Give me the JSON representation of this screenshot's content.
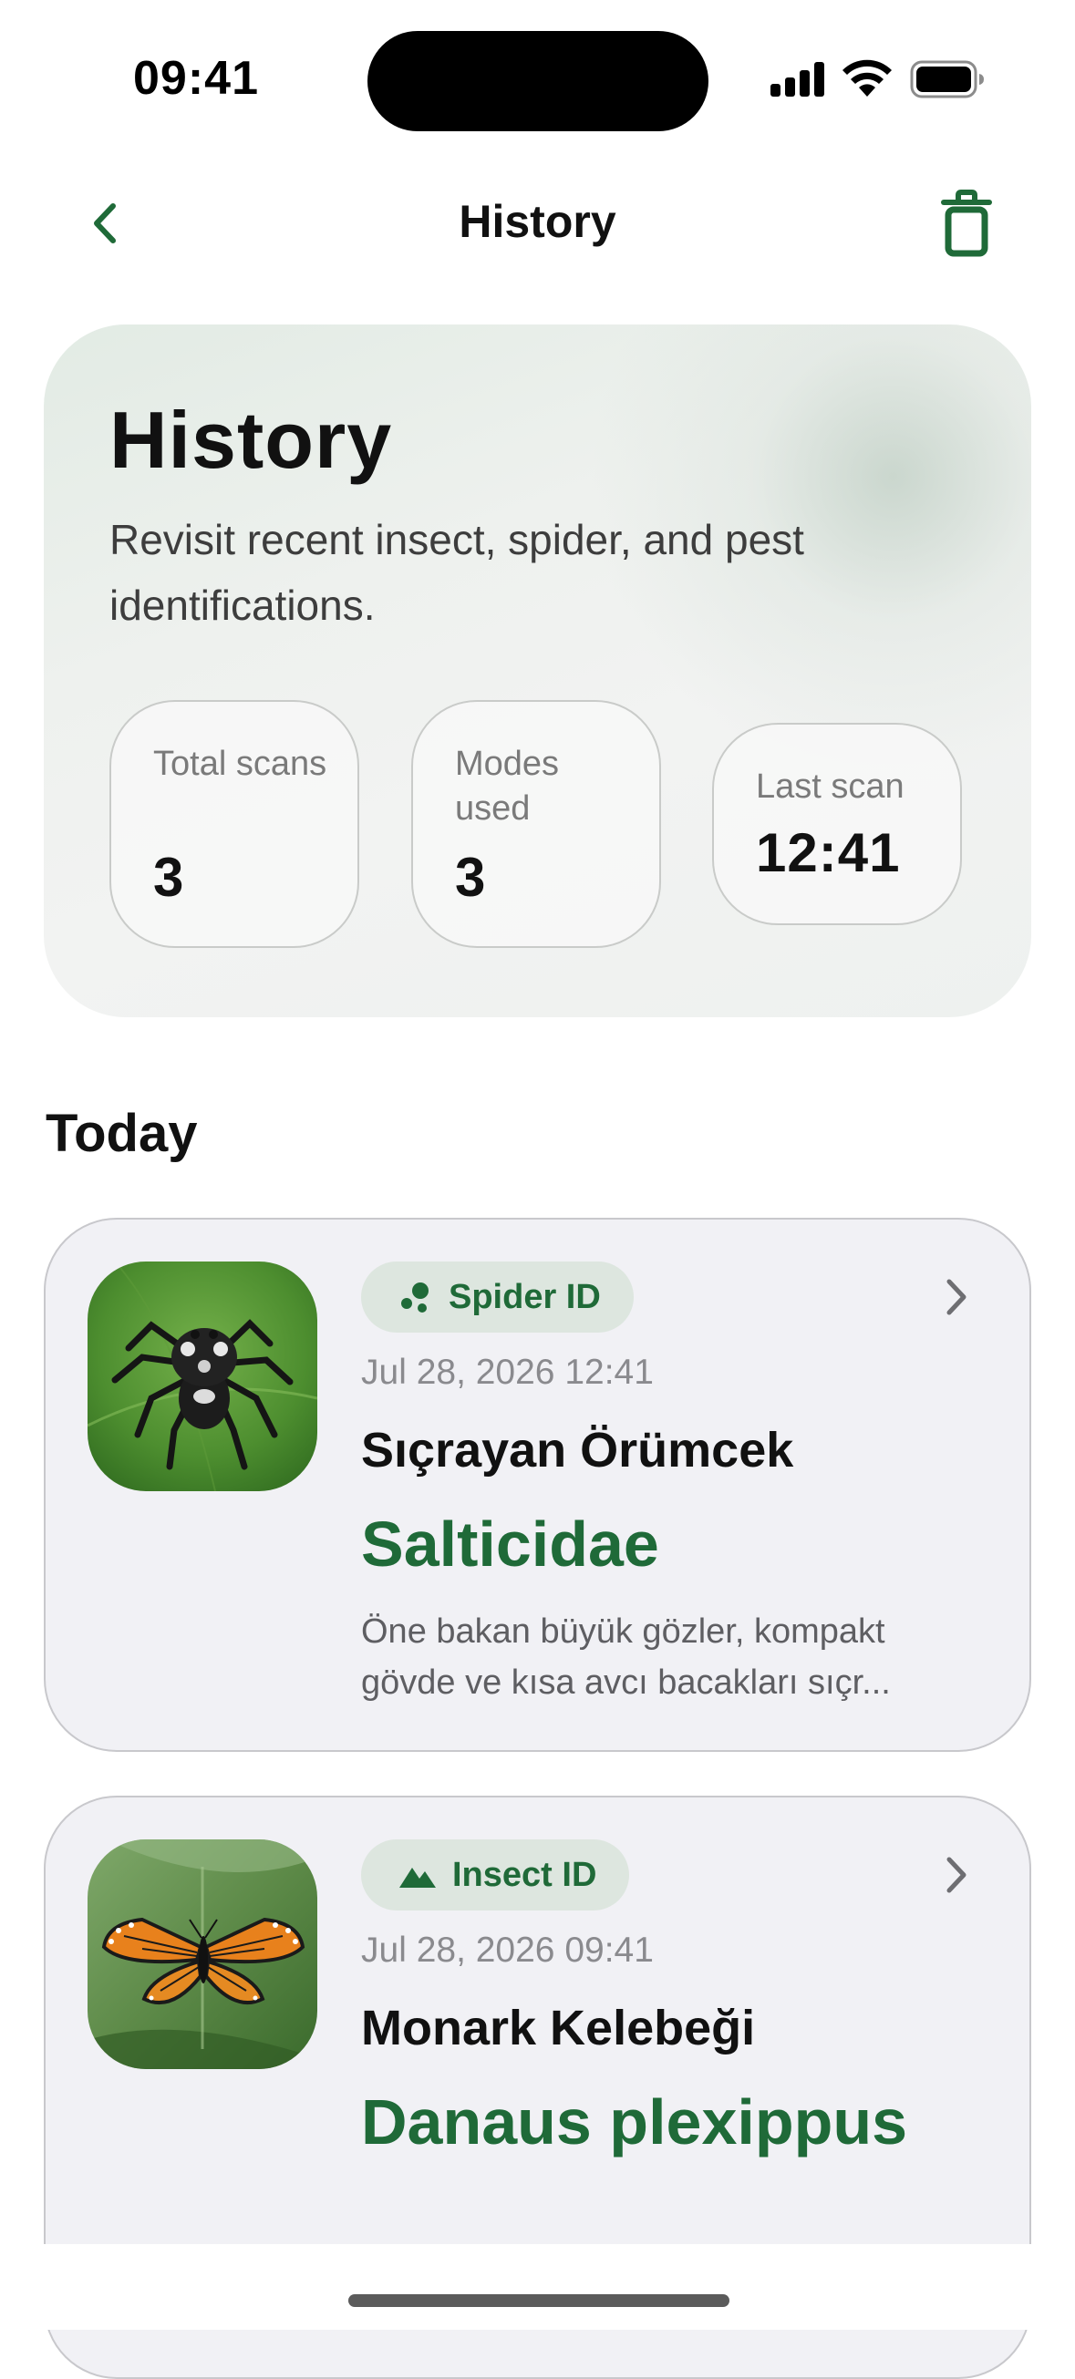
{
  "status_bar": {
    "time": "09:41"
  },
  "nav": {
    "title": "History",
    "back_icon": "chevron-left-icon",
    "trash_icon": "trash-icon"
  },
  "hero": {
    "title": "History",
    "subtitle": "Revisit recent insect, spider, and pest identifications.",
    "stats": [
      {
        "label": "Total scans",
        "value": "3"
      },
      {
        "label": "Modes used",
        "value": "3"
      },
      {
        "label": "Last scan",
        "value": "12:41"
      }
    ]
  },
  "section": {
    "title": "Today"
  },
  "cards": [
    {
      "mode": "Spider ID",
      "mode_icon": "spider-dots-icon",
      "date": "Jul 28, 2026 12:41",
      "common_name": "Sıçrayan Örümcek",
      "scientific_name": "Salticidae",
      "description_line1": "Öne bakan büyük gözler, kompakt",
      "description_line2": "gövde ve kısa avcı bacakları sıçr..."
    },
    {
      "mode": "Insect ID",
      "mode_icon": "mountain-icon",
      "date": "Jul 28, 2026 09:41",
      "common_name": "Monark Kelebeği",
      "scientific_name": "Danaus plexippus"
    }
  ],
  "colors": {
    "accent_green": "#1f6a38",
    "chip_bg": "#dde6df",
    "card_bg": "#f1f1f5"
  }
}
